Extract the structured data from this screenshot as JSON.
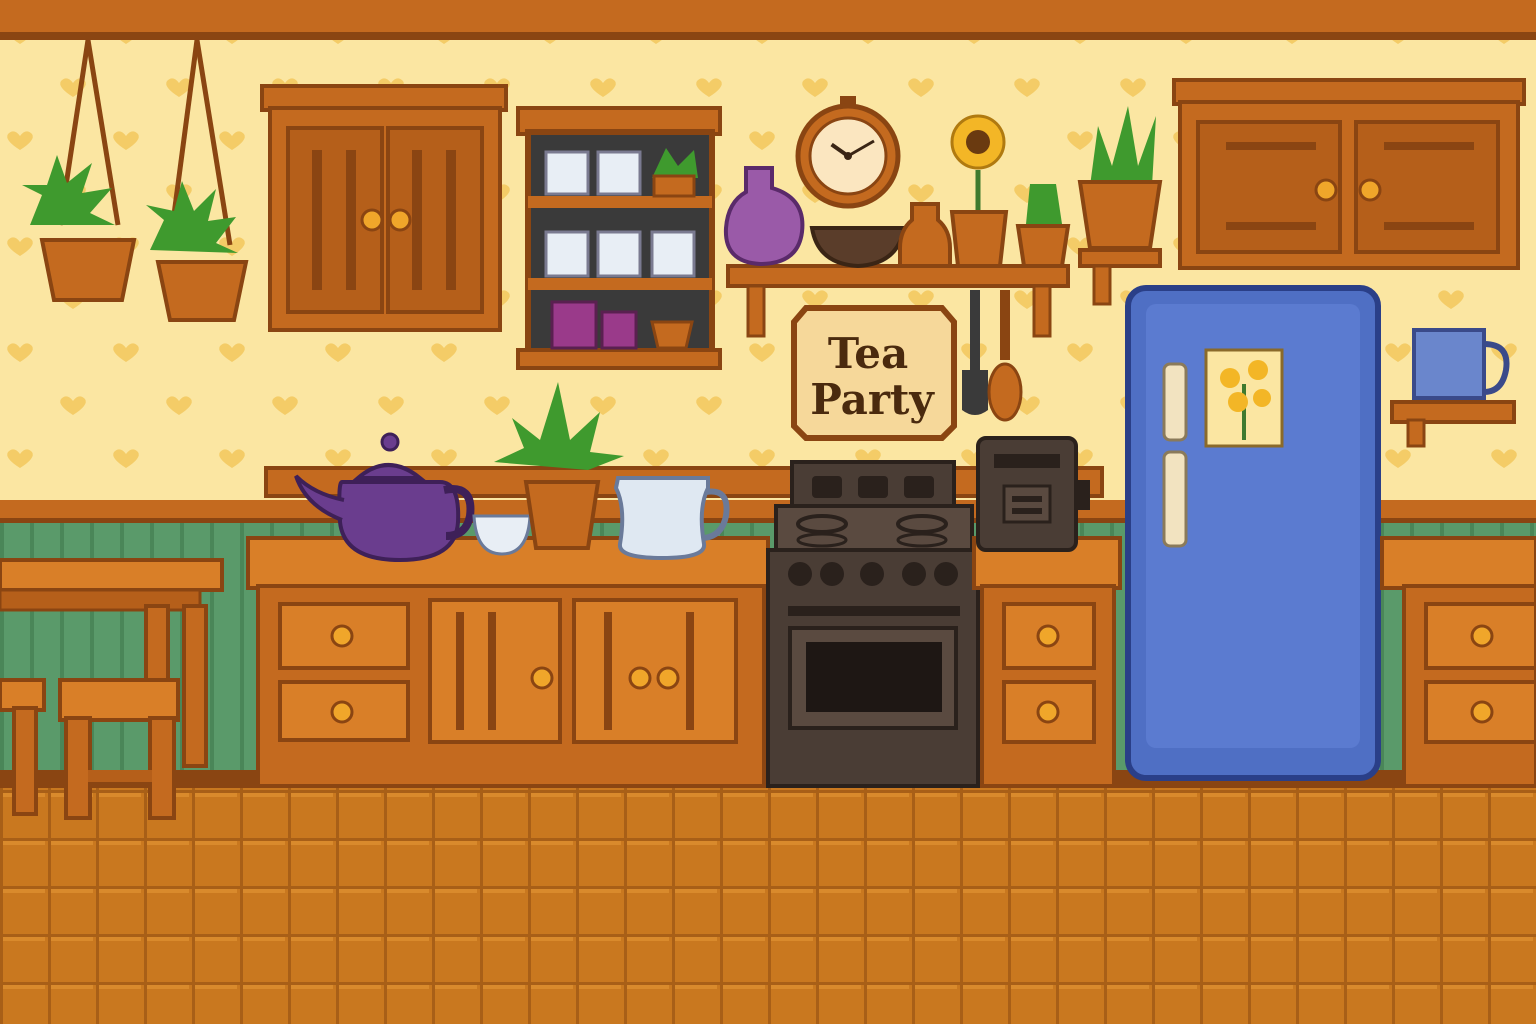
{
  "scene": {
    "name": "Kitchen",
    "style": "pixel-art interior"
  },
  "sign": {
    "line1": "Tea",
    "line2": "Party"
  },
  "clock": {
    "hour": 10,
    "minute": 10
  },
  "colors": {
    "wallpaper": "#fbe6a2",
    "heart": "#f1c252",
    "wood": "#c46a1f",
    "wood_dark": "#8a4512",
    "wainscot": "#5a9a6a",
    "floor": "#c9781f",
    "fridge": "#4f6fc4",
    "stove": "#4a3d35",
    "teapot": "#6a3d8e",
    "plant": "#3f9a2e"
  },
  "icons": [
    "hanging-plant-icon",
    "cabinet-icon",
    "cup-shelf-icon",
    "clock-icon",
    "sunflower-icon",
    "vase-icon",
    "bowl-icon",
    "teapot-icon",
    "teacup-icon",
    "pitcher-icon",
    "stove-icon",
    "toaster-icon",
    "fridge-icon",
    "mug-icon",
    "table-icon",
    "stool-icon",
    "utensils-icon"
  ]
}
